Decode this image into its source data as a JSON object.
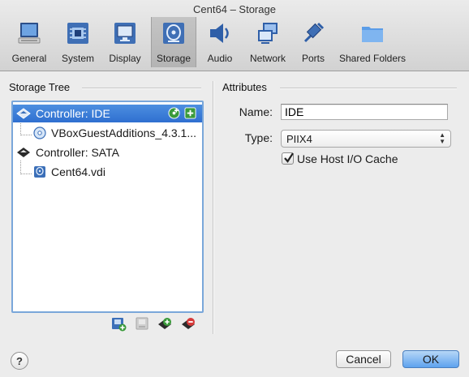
{
  "window": {
    "title": "Cent64 – Storage"
  },
  "toolbar": {
    "items": [
      {
        "label": "General",
        "icon": "monitor-general-icon"
      },
      {
        "label": "System",
        "icon": "chip-icon"
      },
      {
        "label": "Display",
        "icon": "display-icon"
      },
      {
        "label": "Storage",
        "icon": "disk-storage-icon",
        "selected": true
      },
      {
        "label": "Audio",
        "icon": "speaker-icon"
      },
      {
        "label": "Network",
        "icon": "network-icon"
      },
      {
        "label": "Ports",
        "icon": "ports-icon"
      },
      {
        "label": "Shared Folders",
        "icon": "folder-icon"
      }
    ]
  },
  "storage_tree": {
    "title": "Storage Tree",
    "items": [
      {
        "label": "Controller: IDE",
        "type": "controller",
        "selected": true
      },
      {
        "label": "VBoxGuestAdditions_4.3.1...",
        "type": "optical-disc"
      },
      {
        "label": "Controller: SATA",
        "type": "controller"
      },
      {
        "label": "Cent64.vdi",
        "type": "hard-disk"
      }
    ]
  },
  "attributes": {
    "title": "Attributes",
    "name_label": "Name:",
    "name_value": "IDE",
    "type_label": "Type:",
    "type_value": "PIIX4",
    "cache_label": "Use Host I/O Cache",
    "cache_checked": true
  },
  "buttons": {
    "help": "?",
    "cancel": "Cancel",
    "ok": "OK"
  },
  "colors": {
    "selection": "#3c7fd9",
    "accent": "#5ea2ee"
  }
}
